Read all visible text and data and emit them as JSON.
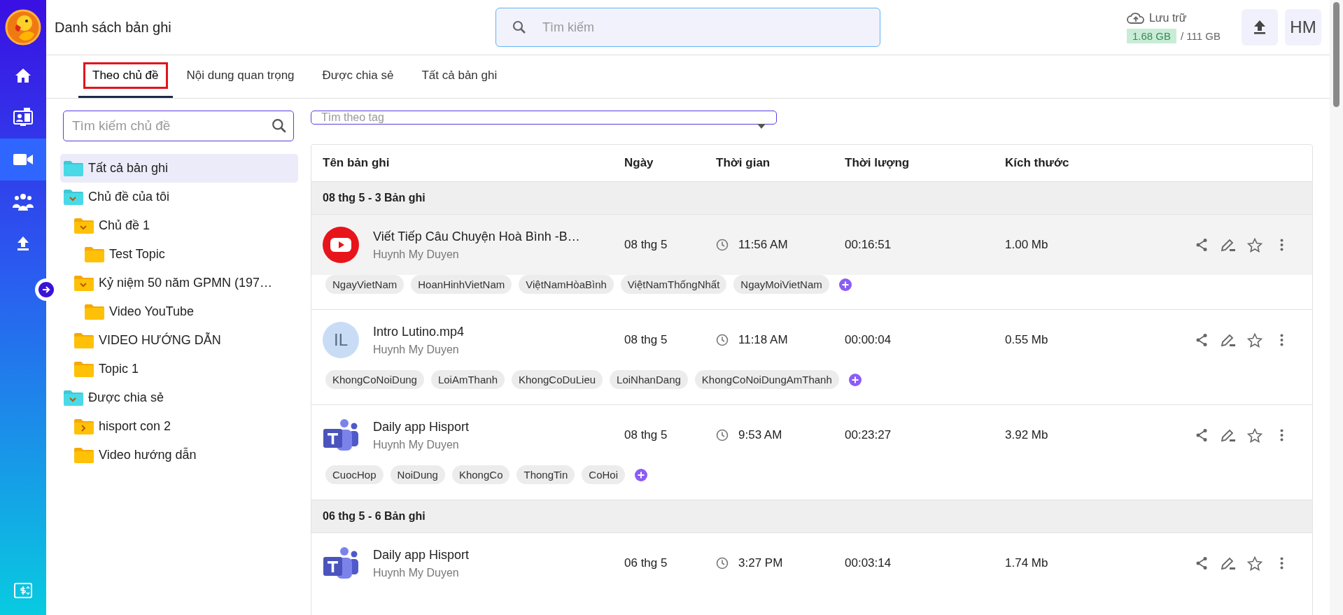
{
  "app": {
    "title": "Danh sách bản ghi"
  },
  "nav": [
    {
      "kind": "home",
      "selected": false
    },
    {
      "kind": "meeting",
      "selected": false
    },
    {
      "kind": "video",
      "selected": true
    },
    {
      "kind": "group",
      "selected": false
    },
    {
      "kind": "upload",
      "selected": false
    }
  ],
  "nav_bottom": {
    "kind": "billing"
  },
  "search": {
    "placeholder": "Tìm kiếm"
  },
  "storage": {
    "label": "Lưu trữ",
    "used": "1.68 GB",
    "total": "/ 111 GB"
  },
  "user": {
    "initials": "HM"
  },
  "tabs": [
    {
      "label": "Theo chủ đề",
      "selected": true
    },
    {
      "label": "Nội dung quan trọng",
      "selected": false
    },
    {
      "label": "Được chia sẻ",
      "selected": false
    },
    {
      "label": "Tất cả bản ghi",
      "selected": false
    }
  ],
  "topic_search": {
    "placeholder": "Tìm kiếm chủ đề"
  },
  "tag_filter": {
    "placeholder": "Tìm theo tag"
  },
  "topics": [
    {
      "label": "Tất cả bản ghi",
      "kind": "collection",
      "selected": true
    },
    {
      "label": "Chủ đề của tôi",
      "kind": "collection",
      "selected": false,
      "expanded": true,
      "children": [
        {
          "label": "Chủ đề 1",
          "kind": "folder",
          "selected": false,
          "expanded": true,
          "children": [
            {
              "label": "Test Topic",
              "kind": "folder",
              "selected": false
            }
          ]
        },
        {
          "label": "Kỷ niệm 50 năm GPMN (197…",
          "kind": "folder",
          "selected": false,
          "expanded": true,
          "children": [
            {
              "label": "Video YouTube",
              "kind": "folder",
              "selected": false
            }
          ]
        },
        {
          "label": "VIDEO HƯỚNG DẪN",
          "kind": "folder",
          "selected": false
        },
        {
          "label": "Topic 1",
          "kind": "folder",
          "selected": false
        }
      ]
    },
    {
      "label": "Được chia sẻ",
      "kind": "shared",
      "selected": false,
      "expanded": true,
      "children": [
        {
          "label": "hisport con 2",
          "kind": "folder",
          "selected": false,
          "expanded": false
        },
        {
          "label": "Video hướng dẫn",
          "kind": "folder",
          "selected": false
        }
      ]
    }
  ],
  "table": {
    "columns": [
      "Tên bản ghi",
      "Ngày",
      "Thời gian",
      "Thời lượng",
      "Kích thước"
    ],
    "groups": [
      {
        "title": "08 thg 5 - 3 Bản ghi",
        "rows": [
          {
            "kind": "youtube",
            "title": "Viết Tiếp Câu Chuyện Hoà Bình -B…",
            "owner": "Huynh My Duyen",
            "date": "08 thg 5",
            "time": "11:56 AM",
            "duration": "00:16:51",
            "size": "1.00 Mb",
            "highlighted": true,
            "tags": [
              "NgayVietNam",
              "HoanHinhVietNam",
              "ViệtNamHòaBình",
              "ViệtNamThốngNhất",
              "NgayMoiVietNam"
            ]
          },
          {
            "kind": "initials",
            "initials": "IL",
            "title": "Intro Lutino.mp4",
            "owner": "Huynh My Duyen",
            "date": "08 thg 5",
            "time": "11:18 AM",
            "duration": "00:00:04",
            "size": "0.55 Mb",
            "highlighted": false,
            "tags": [
              "KhongCoNoiDung",
              "LoiAmThanh",
              "KhongCoDuLieu",
              "LoiNhanDang",
              "KhongCoNoiDungAmThanh"
            ]
          },
          {
            "kind": "teams",
            "title": "Daily app Hisport",
            "owner": "Huynh My Duyen",
            "date": "08 thg 5",
            "time": "9:53 AM",
            "duration": "00:23:27",
            "size": "3.92 Mb",
            "highlighted": false,
            "tags": [
              "CuocHop",
              "NoiDung",
              "KhongCo",
              "ThongTin",
              "CoHoi"
            ]
          }
        ]
      },
      {
        "title": "06 thg 5 - 6 Bản ghi",
        "rows": [
          {
            "kind": "teams",
            "title": "Daily app Hisport",
            "owner": "Huynh My Duyen",
            "date": "06 thg 5",
            "time": "3:27 PM",
            "duration": "00:03:14",
            "size": "1.74 Mb",
            "highlighted": false
          }
        ]
      }
    ]
  }
}
